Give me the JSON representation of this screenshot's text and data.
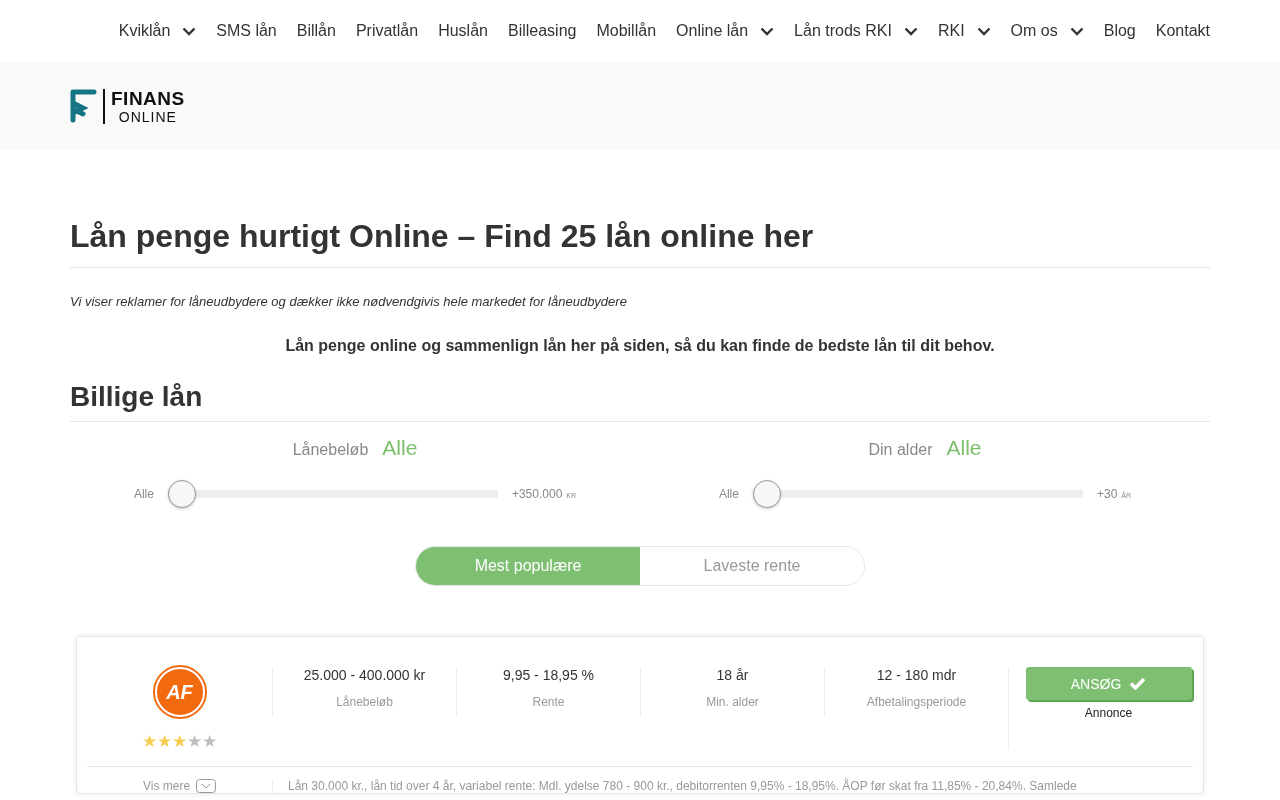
{
  "nav": {
    "items": [
      {
        "label": "Kviklån",
        "dropdown": true
      },
      {
        "label": "SMS lån",
        "dropdown": false
      },
      {
        "label": "Billån",
        "dropdown": false
      },
      {
        "label": "Privatlån",
        "dropdown": false
      },
      {
        "label": "Huslån",
        "dropdown": false
      },
      {
        "label": "Billeasing",
        "dropdown": false
      },
      {
        "label": "Mobillån",
        "dropdown": false
      },
      {
        "label": "Online lån",
        "dropdown": true
      },
      {
        "label": "Lån trods RKI",
        "dropdown": true
      },
      {
        "label": "RKI",
        "dropdown": true
      },
      {
        "label": "Om os",
        "dropdown": true
      },
      {
        "label": "Blog",
        "dropdown": false
      },
      {
        "label": "Kontakt",
        "dropdown": false
      }
    ]
  },
  "logo": {
    "line1": "FINANS",
    "line2": "ONLINE"
  },
  "title": "Lån penge hurtigt Online – Find 25 lån online her",
  "disclaimer": "Vi viser reklamer for låneudbydere og dækker ikke nødvendgivis hele markedet for låneudbydere",
  "intro": "Lån penge online og sammenlign lån her på siden, så du kan finde de bedste lån til dit behov.",
  "section_title": "Billige lån",
  "filters": [
    {
      "label": "Lånebeløb",
      "value": "Alle",
      "min_label": "Alle",
      "max_label": "+350.000",
      "max_unit": "KR",
      "level": 0
    },
    {
      "label": "Din alder",
      "value": "Alle",
      "min_label": "Alle",
      "max_label": "+30",
      "max_unit": "ÅR",
      "level": 0
    }
  ],
  "sort_tabs": [
    {
      "label": "Mest populære",
      "selected": true
    },
    {
      "label": "Laveste rente",
      "selected": false
    }
  ],
  "offers": [
    {
      "logo_text": "AF",
      "stars": 3,
      "stats": [
        {
          "value": "25.000 - 400.000 kr",
          "label": "Lånebeløb"
        },
        {
          "value": "9,95 - 18,95 %",
          "label": "Rente"
        },
        {
          "value": "18 år",
          "label": "Min. alder"
        },
        {
          "value": "12 - 180 mdr",
          "label": "Afbetalingsperiode"
        }
      ],
      "button": "ANSØG",
      "ad_label": "Annonce",
      "more": "Vis mere",
      "terms": "Lån 30.000 kr., lån tid over 4 år, variabel rente: Mdl. ydelse 780 - 900 kr., debitorrenten 9,95% - 18,95%. ÅOP før skat fra 11,85% - 20,84%. Samlede"
    }
  ]
}
